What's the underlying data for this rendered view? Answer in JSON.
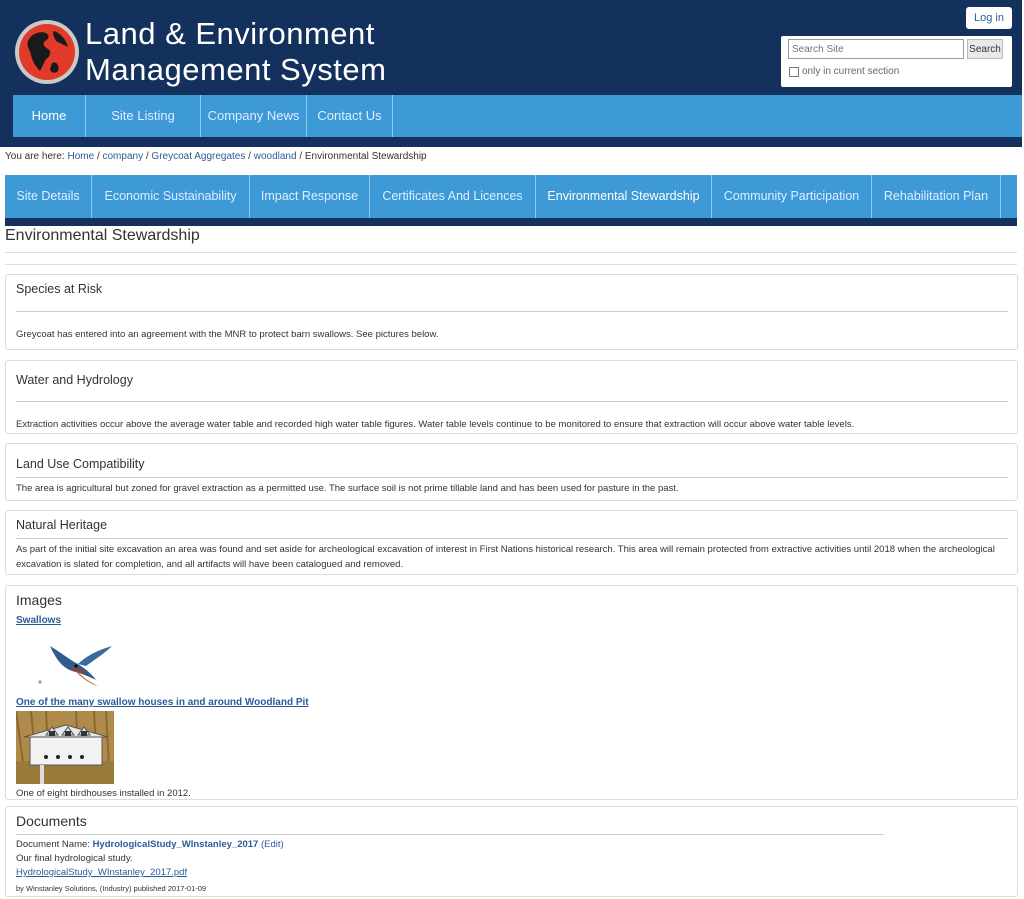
{
  "header": {
    "title_line1": "Land & Environment",
    "title_line2": "Management System",
    "login_label": "Log in",
    "search_placeholder": "Search Site",
    "search_button": "Search",
    "only_section_label": "only in current section"
  },
  "main_nav": [
    {
      "label": "Home"
    },
    {
      "label": "Site Listing"
    },
    {
      "label": "Company News"
    },
    {
      "label": "Contact Us"
    }
  ],
  "breadcrumb": {
    "prefix": "You are here:",
    "items": [
      "Home",
      "company",
      "Greycoat Aggregates",
      "woodland"
    ],
    "current": "Environmental Stewardship",
    "separator": "/"
  },
  "sub_nav": [
    {
      "label": "Site Details"
    },
    {
      "label": "Economic Sustainability"
    },
    {
      "label": "Impact Response"
    },
    {
      "label": "Certificates And Licences"
    },
    {
      "label": "Environmental Stewardship"
    },
    {
      "label": "Community Participation"
    },
    {
      "label": "Rehabilitation Plan"
    }
  ],
  "page_title": "Environmental Stewardship",
  "sections": {
    "species": {
      "title": "Species at Risk",
      "text": "Greycoat has entered into an agreement with the MNR to protect barn swallows. See pictures below."
    },
    "water": {
      "title": "Water and Hydrology",
      "text": "Extraction activities occur above the average water table and recorded high water table figures.  Water table levels continue to be monitored to ensure that extraction will occur above water table levels."
    },
    "land_use": {
      "title": "Land Use Compatibility",
      "text": "The area is agricultural but zoned for gravel extraction as a permitted use.  The surface soil is not prime tillable land and has been used for pasture in the past."
    },
    "heritage": {
      "title": "Natural Heritage",
      "text": "As part of the initial site excavation an area was found and set aside for archeological excavation of interest in First Nations historical research.  This area will remain protected from extractive activities until 2018 when the archeological excavation is slated for completion, and all artifacts will have been catalogued and removed."
    }
  },
  "images": {
    "title": "Images",
    "image1_link": "Swallows",
    "image2_link": "One of the many swallow houses in and around Woodland Pit",
    "image2_caption": "One of eight birdhouses installed in 2012."
  },
  "documents": {
    "title": "Documents",
    "name_label": "Document Name:",
    "name_value": "HydrologicalStudy_WInstanley_2017",
    "edit_label": "(Edit)",
    "description": "Our final hydrological study.",
    "file_link": "HydrologicalStudy_WInstanley_2017.pdf",
    "published": "by Winstanley Solutions, (Industry) published 2017-01-09"
  },
  "colors": {
    "header_bg": "#13315c",
    "nav_bg": "#3e9ad6",
    "link": "#2a5c9a"
  }
}
